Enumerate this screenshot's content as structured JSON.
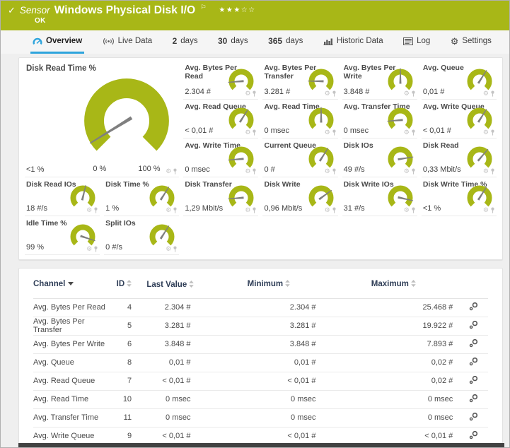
{
  "colors": {
    "brand_green": "#a8b717",
    "accent_blue": "#2da4dc",
    "header_navy": "#2f3e57",
    "needle_gray": "#7f7f7f",
    "footer_dark": "#424242"
  },
  "header": {
    "status_icon": "check-icon",
    "kind_label": "Sensor",
    "title": "Windows Physical Disk I/O",
    "flag_icon": "flag-icon",
    "rating": {
      "filled": 3,
      "total": 5
    },
    "status": "OK"
  },
  "tabs": [
    {
      "name": "overview",
      "icon": "gauge-icon",
      "label": "Overview",
      "active": true
    },
    {
      "name": "live-data",
      "icon": "live-data-icon",
      "label": "Live Data",
      "active": false
    },
    {
      "name": "2-days",
      "num": "2",
      "label": "days",
      "active": false
    },
    {
      "name": "30-days",
      "num": "30",
      "label": "days",
      "active": false
    },
    {
      "name": "365-days",
      "num": "365",
      "label": "days",
      "active": false
    },
    {
      "name": "historic-data",
      "icon": "chart-icon",
      "label": "Historic Data",
      "active": false
    },
    {
      "name": "log",
      "icon": "log-icon",
      "label": "Log",
      "active": false
    },
    {
      "name": "settings",
      "icon": "gear-icon",
      "label": "Settings",
      "active": false
    }
  ],
  "gauges": {
    "primary": {
      "title": "Disk Read Time %",
      "value": "<1 %",
      "scale_min": "0 %",
      "scale_max": "100 %",
      "fraction": 0.05
    },
    "small": [
      {
        "title": "Avg. Bytes Per Read",
        "value": "2.304 #",
        "fraction": 0.15,
        "row": 1,
        "col": 3
      },
      {
        "title": "Avg. Bytes Per Transfer",
        "value": "3.281 #",
        "fraction": 0.17,
        "row": 1,
        "col": 4
      },
      {
        "title": "Avg. Bytes Per Write",
        "value": "3.848 #",
        "fraction": 0.5,
        "row": 1,
        "col": 5
      },
      {
        "title": "Avg. Queue",
        "value": "0,01 #",
        "fraction": 0.62,
        "row": 1,
        "col": 6
      },
      {
        "title": "Avg. Read Queue",
        "value": "< 0,01 #",
        "fraction": 0.62,
        "row": 2,
        "col": 3
      },
      {
        "title": "Avg. Read Time",
        "value": "0 msec",
        "fraction": 0.5,
        "row": 2,
        "col": 4
      },
      {
        "title": "Avg. Transfer Time",
        "value": "0 msec",
        "fraction": 0.15,
        "row": 2,
        "col": 5
      },
      {
        "title": "Avg. Write Queue",
        "value": "< 0,01 #",
        "fraction": 0.62,
        "row": 2,
        "col": 6
      },
      {
        "title": "Avg. Write Time",
        "value": "0 msec",
        "fraction": 0.15,
        "row": 3,
        "col": 3
      },
      {
        "title": "Current Queue",
        "value": "0 #",
        "fraction": 0.62,
        "row": 3,
        "col": 4
      },
      {
        "title": "Disk IOs",
        "value": "49 #/s",
        "fraction": 0.8,
        "row": 3,
        "col": 5
      },
      {
        "title": "Disk Read",
        "value": "0,33 Mbit/s",
        "fraction": 0.65,
        "row": 3,
        "col": 6
      },
      {
        "title": "Disk Read IOs",
        "value": "18 #/s",
        "fraction": 0.55,
        "row": 4,
        "col": 1
      },
      {
        "title": "Disk Time %",
        "value": "1 %",
        "fraction": 0.62,
        "row": 4,
        "col": 2
      },
      {
        "title": "Disk Transfer",
        "value": "1,29 Mbit/s",
        "fraction": 0.15,
        "row": 4,
        "col": 3
      },
      {
        "title": "Disk Write",
        "value": "0,96 Mbit/s",
        "fraction": 0.7,
        "row": 4,
        "col": 4
      },
      {
        "title": "Disk Write IOs",
        "value": "31 #/s",
        "fraction": 0.88,
        "row": 4,
        "col": 5
      },
      {
        "title": "Disk Write Time %",
        "value": "<1 %",
        "fraction": 0.62,
        "row": 4,
        "col": 6
      },
      {
        "title": "Idle Time %",
        "value": "99 %",
        "fraction": 0.9,
        "row": 5,
        "col": 1
      },
      {
        "title": "Split IOs",
        "value": "0 #/s",
        "fraction": 0.62,
        "row": 5,
        "col": 2
      }
    ],
    "cell_icons": [
      "gear-icon",
      "pin-icon"
    ]
  },
  "table": {
    "columns": [
      {
        "key": "channel",
        "label": "Channel",
        "sorter": "caret"
      },
      {
        "key": "id",
        "label": "ID",
        "sorter": "updown"
      },
      {
        "key": "last",
        "label": "Last Value",
        "sorter": "updown"
      },
      {
        "key": "min",
        "label": "Minimum",
        "sorter": "updown"
      },
      {
        "key": "max",
        "label": "Maximum",
        "sorter": "updown"
      }
    ],
    "row_icon": "edit-channel-icon",
    "rows": [
      {
        "channel": "Avg. Bytes Per Read",
        "id": "4",
        "last": "2.304 #",
        "min": "2.304 #",
        "max": "25.468 #"
      },
      {
        "channel": "Avg. Bytes Per Transfer",
        "id": "5",
        "last": "3.281 #",
        "min": "3.281 #",
        "max": "19.922 #"
      },
      {
        "channel": "Avg. Bytes Per Write",
        "id": "6",
        "last": "3.848 #",
        "min": "3.848 #",
        "max": "7.893 #"
      },
      {
        "channel": "Avg. Queue",
        "id": "8",
        "last": "0,01 #",
        "min": "0,01 #",
        "max": "0,02 #"
      },
      {
        "channel": "Avg. Read Queue",
        "id": "7",
        "last": "< 0,01 #",
        "min": "< 0,01 #",
        "max": "0,02 #"
      },
      {
        "channel": "Avg. Read Time",
        "id": "10",
        "last": "0 msec",
        "min": "0 msec",
        "max": "0 msec"
      },
      {
        "channel": "Avg. Transfer Time",
        "id": "11",
        "last": "0 msec",
        "min": "0 msec",
        "max": "0 msec"
      },
      {
        "channel": "Avg. Write Queue",
        "id": "9",
        "last": "< 0,01 #",
        "min": "< 0,01 #",
        "max": "< 0,01 #"
      }
    ]
  }
}
